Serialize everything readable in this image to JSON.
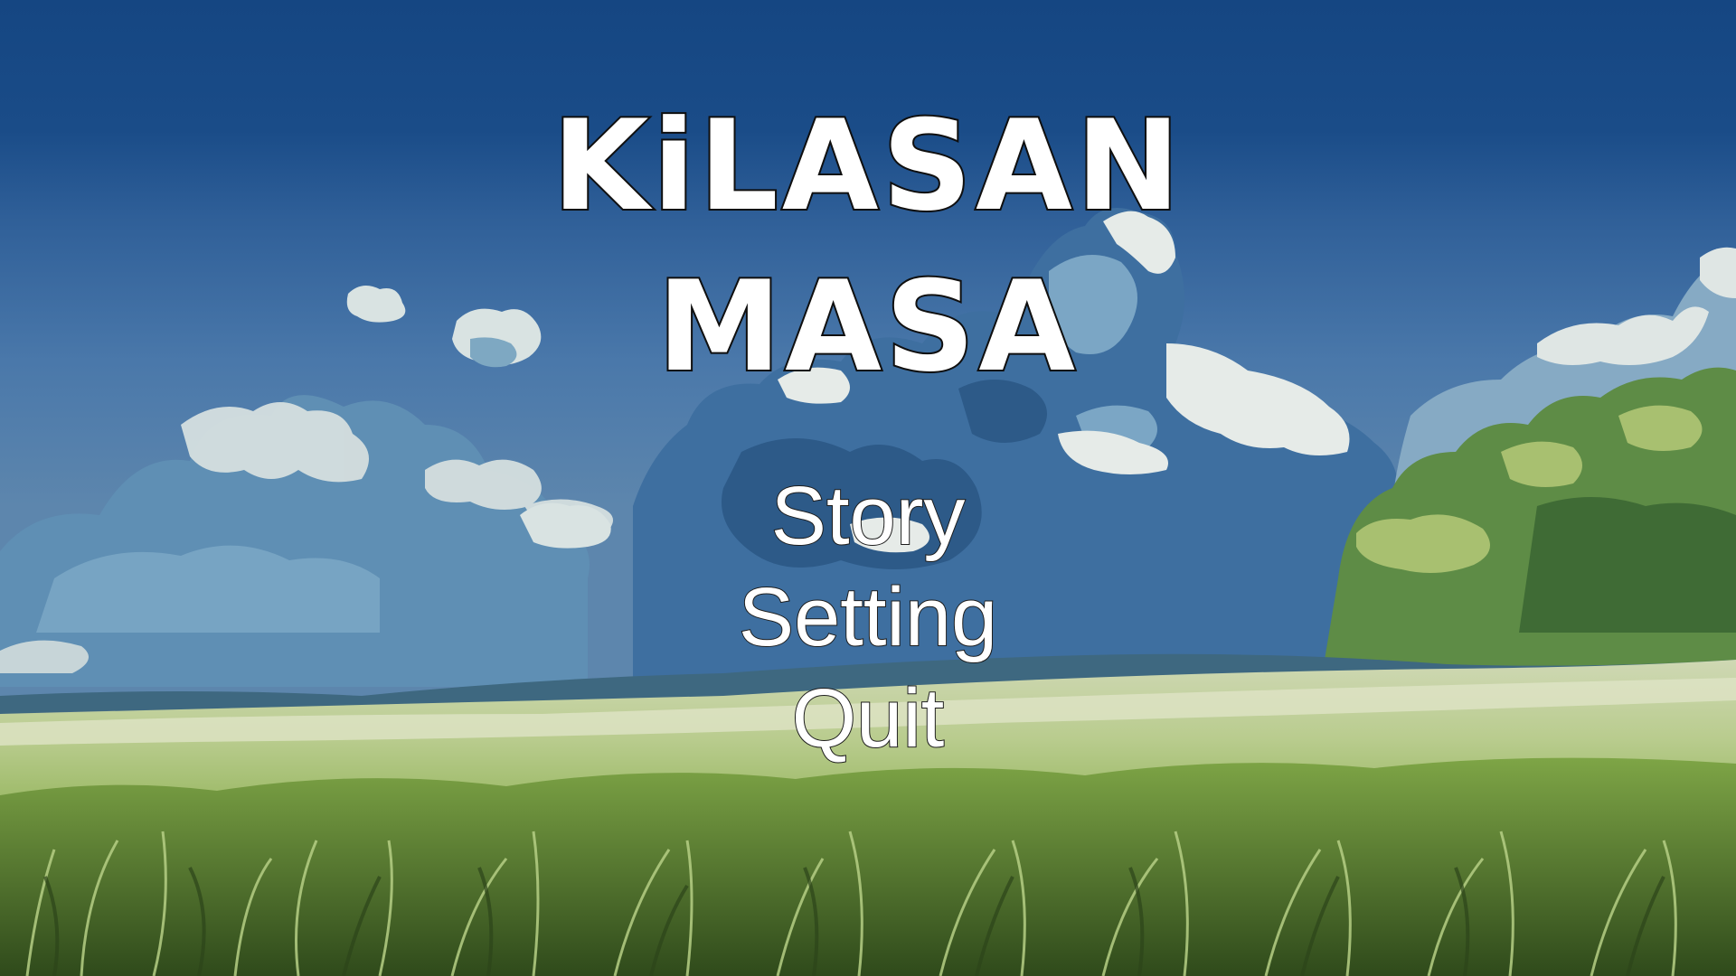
{
  "game": {
    "title_lines": [
      "KiLASAN",
      "MASA"
    ],
    "menu": [
      {
        "label": "Story"
      },
      {
        "label": "Setting"
      },
      {
        "label": "Quit"
      }
    ]
  },
  "background": {
    "description_icon": "sky-meadow-background",
    "colors": {
      "sky_top": "#174a86",
      "sky_mid": "#3f72a8",
      "cloud_white": "#e8ecea",
      "cloud_blue": "#6f9dbd",
      "tree_green": "#6f9a4e",
      "field_light": "#c9d7a8",
      "grass_green": "#6f9a3c",
      "grass_dark": "#3b5a22"
    }
  }
}
